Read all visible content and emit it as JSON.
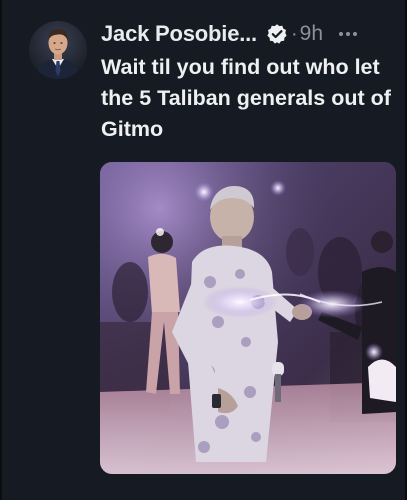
{
  "tweet": {
    "author_name": "Jack Posobie...",
    "separator": "·",
    "time": "9h",
    "text": "Wait til you find out who let the 5 Taliban generals out of Gitmo",
    "verified": true
  },
  "icons": {
    "avatar": "profile-photo",
    "verified": "verified-badge-icon",
    "more": "more-options-icon"
  },
  "colors": {
    "background": "#161a22",
    "text_primary": "#eef0f2",
    "text_secondary": "#8b929c"
  }
}
